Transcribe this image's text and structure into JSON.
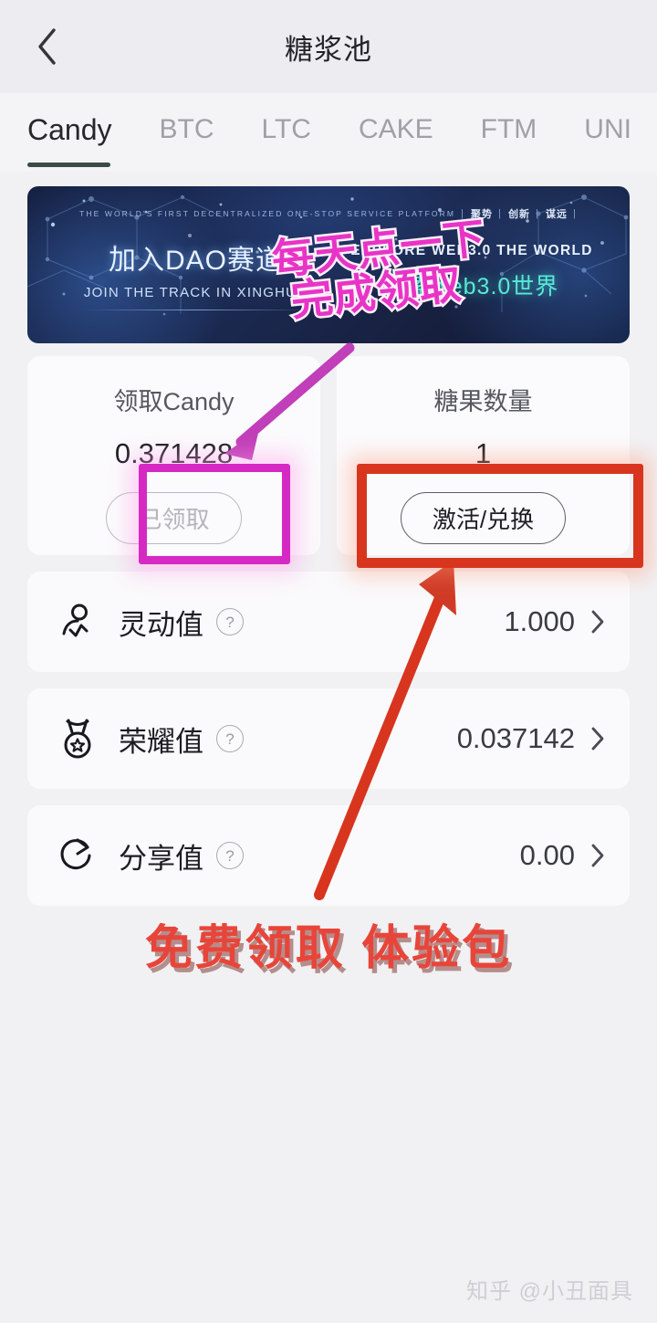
{
  "header": {
    "title": "糖浆池",
    "back_icon": "chevron-left-icon"
  },
  "tabs": [
    {
      "label": "Candy",
      "active": true
    },
    {
      "label": "BTC",
      "active": false
    },
    {
      "label": "LTC",
      "active": false
    },
    {
      "label": "CAKE",
      "active": false
    },
    {
      "label": "FTM",
      "active": false
    },
    {
      "label": "UNI",
      "active": false
    }
  ],
  "banner": {
    "tagline_en": "THE WORLD'S FIRST DECENTRALIZED ONE-STOP SERVICE PLATFORM",
    "keywords": [
      "聚势",
      "创新",
      "谋远"
    ],
    "separator": "|",
    "left_cn": "加入DAO赛道",
    "left_en": "JOIN THE TRACK IN XINGHUO",
    "right_en": "EXPLORE WEB3.0 THE WORLD",
    "right_cn": "探索web3.0世界"
  },
  "cards": [
    {
      "title": "领取Candy",
      "value": "0.371428",
      "button_label": "已领取",
      "button_disabled": true
    },
    {
      "title": "糖果数量",
      "value": "1",
      "button_label": "激活/兑换",
      "button_disabled": false
    }
  ],
  "rows": [
    {
      "icon": "person-pulse-icon",
      "label": "灵动值",
      "help": "?",
      "value": "1.000",
      "chevron": "chevron-right-icon"
    },
    {
      "icon": "medal-star-icon",
      "label": "荣耀值",
      "help": "?",
      "value": "0.037142",
      "chevron": "chevron-right-icon"
    },
    {
      "icon": "share-rotate-icon",
      "label": "分享值",
      "help": "?",
      "value": "0.00",
      "chevron": "chevron-right-icon"
    }
  ],
  "annotations": {
    "pink_line1": "每天点一下",
    "pink_line2": "完成领取",
    "bottom_text": "免费领取 体验包",
    "pink_arrow": "arrow-down-left-icon",
    "red_arrow": "arrow-up-right-icon",
    "magenta_box": "highlight-box-claim-button",
    "red_box": "highlight-box-activate-button"
  },
  "watermark": "知乎 @小丑面具",
  "colors": {
    "accent_pink": "#e834c6",
    "accent_magenta": "#d629c4",
    "accent_red": "#d8351f",
    "bottom_red": "#e8453a",
    "banner_teal": "#58e9d6",
    "tab_active": "#25272c"
  }
}
